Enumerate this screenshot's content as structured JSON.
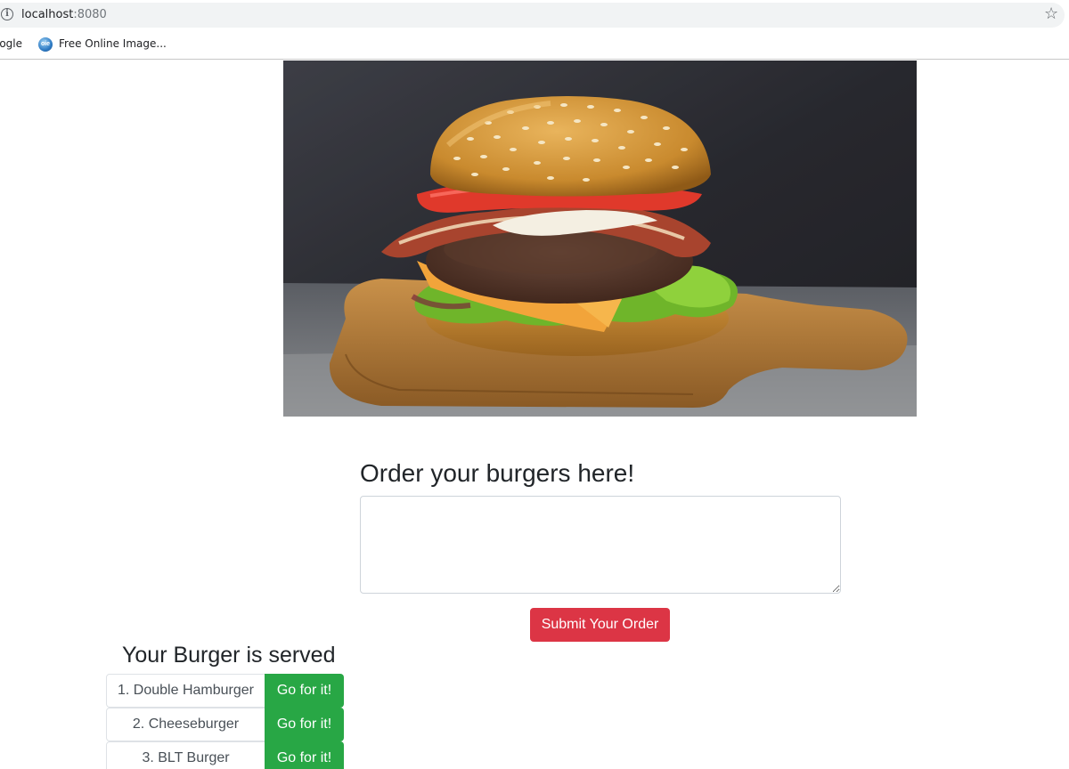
{
  "browser": {
    "url_host": "localhost",
    "url_port": ":8080",
    "bookmarks": [
      {
        "label": "oogle"
      },
      {
        "label": "Free Online Image..."
      }
    ]
  },
  "hero": {
    "image_alt": "Burger on a wooden board"
  },
  "order": {
    "title": "Order your burgers here!",
    "input_value": "",
    "submit_label": "Submit Your Order",
    "submit_color": "#dc3545"
  },
  "served": {
    "title": "Your Burger is served",
    "button_color": "#28a745",
    "items": [
      {
        "name": "1. Double Hamburger",
        "action": "Go for it!"
      },
      {
        "name": "2. Cheeseburger",
        "action": "Go for it!"
      },
      {
        "name": "3. BLT Burger",
        "action": "Go for it!"
      }
    ]
  }
}
